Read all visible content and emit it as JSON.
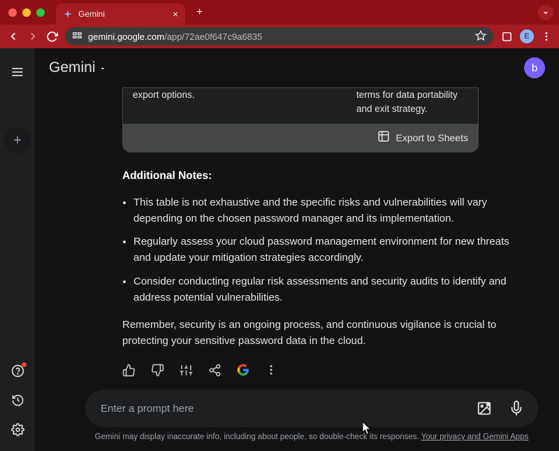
{
  "browser": {
    "tab_title": "Gemini",
    "url_host": "gemini.google.com",
    "url_path": "/app/72ae0f647c9a6835",
    "profile_letter": "E"
  },
  "app": {
    "brand": "Gemini",
    "avatar_letter": "b"
  },
  "table": {
    "cell_left": "export options.",
    "cell_right": "terms for data portability and exit strategy.",
    "export_label": "Export to Sheets"
  },
  "notes": {
    "heading": "Additional Notes:",
    "items": [
      "This table is not exhaustive and the specific risks and vulnerabilities will vary depending on the chosen password manager and its implementation.",
      "Regularly assess your cloud password management environment for new threats and update your mitigation strategies accordingly.",
      "Consider conducting regular risk assessments and security audits to identify and address potential vulnerabilities."
    ],
    "closing": "Remember, security is an ongoing process, and continuous vigilance is crucial to protecting your sensitive password data in the cloud."
  },
  "prompt": {
    "placeholder": "Enter a prompt here"
  },
  "disclaimer": {
    "text": "Gemini may display inaccurate info, including about people, so double-check its responses. ",
    "link": "Your privacy and Gemini Apps"
  }
}
